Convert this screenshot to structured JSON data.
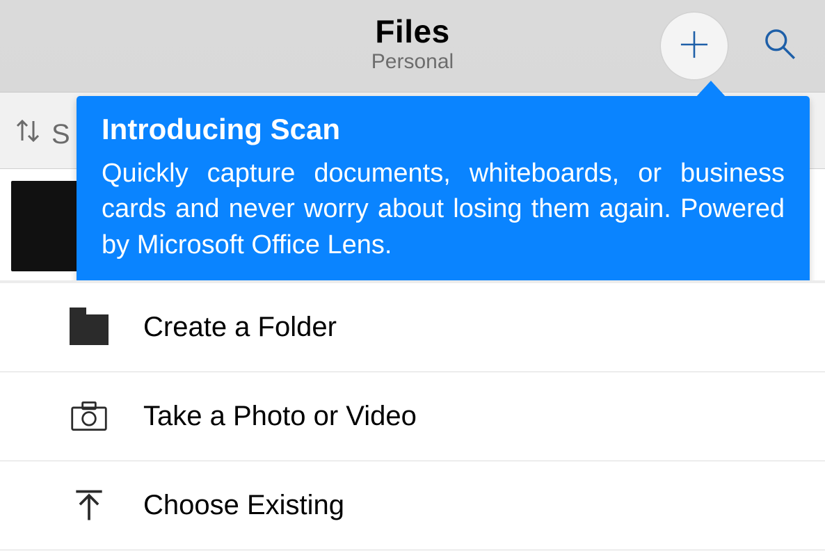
{
  "header": {
    "title": "Files",
    "subtitle": "Personal"
  },
  "sort": {
    "label_fragment": "S"
  },
  "tooltip": {
    "title": "Introducing Scan",
    "body": "Quickly capture documents, whiteboards, or business cards and never worry about losing them again. Powered by Microsoft Office Lens."
  },
  "menu": {
    "items": [
      {
        "label": "Create a Folder",
        "icon": "folder-icon"
      },
      {
        "label": "Take a Photo or Video",
        "icon": "camera-icon"
      },
      {
        "label": "Choose Existing",
        "icon": "upload-arrow-icon"
      }
    ]
  },
  "colors": {
    "tooltip_bg": "#0a84ff",
    "header_bg": "#dadada"
  }
}
